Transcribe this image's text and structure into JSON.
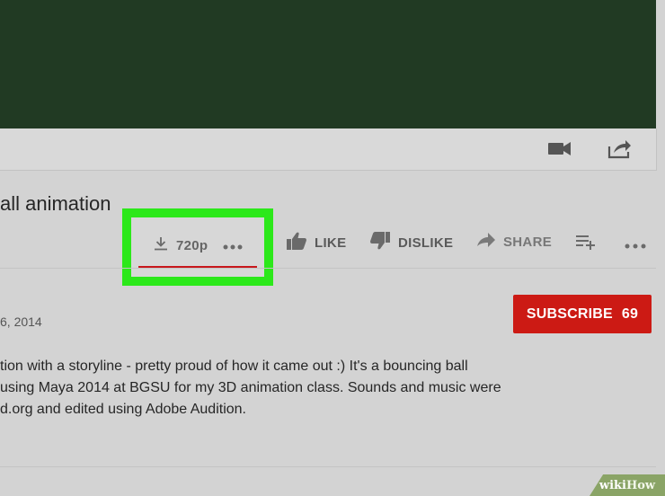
{
  "video": {
    "area": "video-player"
  },
  "controls": {
    "camera_icon": "video-camera-icon",
    "share_icon": "share-arrow-icon"
  },
  "title": "all animation",
  "actions": {
    "download_quality": "720p",
    "like": "LIKE",
    "dislike": "DISLIKE",
    "share": "SHARE"
  },
  "channel": {
    "date": "6, 2014",
    "subscribe_label": "SUBSCRIBE",
    "subscriber_count": "69"
  },
  "description": {
    "lines": [
      "tion with a storyline - pretty proud of how it came out :)  It's a bouncing ball",
      "using Maya 2014 at BGSU for my 3D animation class.  Sounds and music were",
      "d.org and edited using Adobe Audition."
    ]
  },
  "watermark": {
    "wiki": "wiki",
    "how": "How"
  },
  "colors": {
    "highlight": "#2ce81a",
    "subscribe": "#cc1a14",
    "underline": "#c8181c",
    "video_bg": "#213a23"
  }
}
